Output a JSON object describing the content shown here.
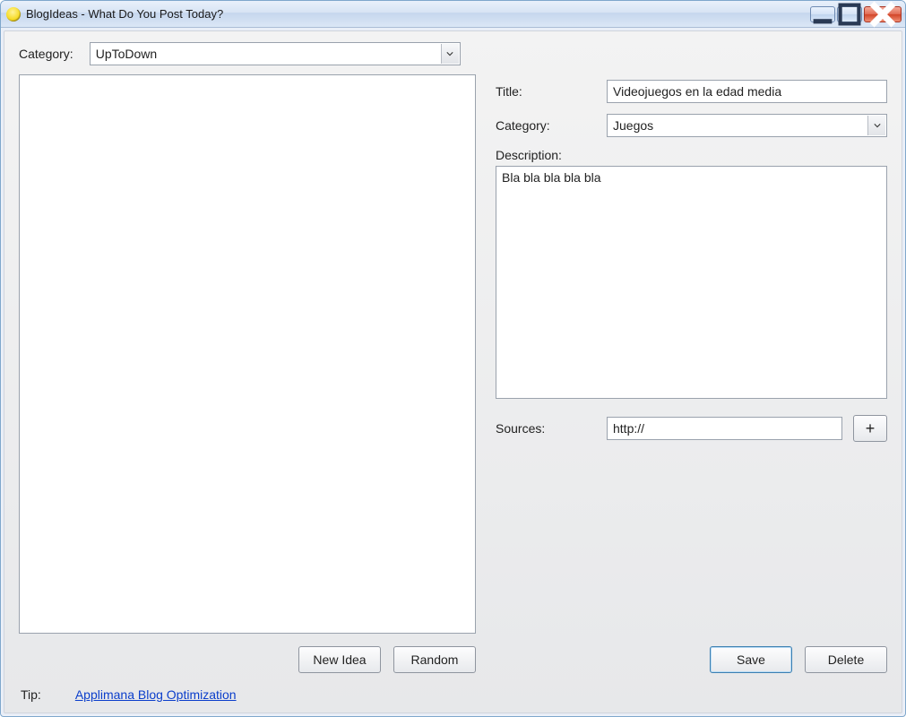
{
  "window": {
    "title": "BlogIdeas - What Do You Post Today?"
  },
  "left": {
    "category_label": "Category:",
    "category_value": "UpToDown",
    "new_idea_label": "New Idea",
    "random_label": "Random"
  },
  "right": {
    "title_label": "Title:",
    "title_value": "Videojuegos en la edad media",
    "category_label": "Category:",
    "category_value": "Juegos",
    "description_label": "Description:",
    "description_value": "Bla bla bla bla bla",
    "sources_label": "Sources:",
    "sources_value": "http://",
    "add_source_label": "+",
    "save_label": "Save",
    "delete_label": "Delete"
  },
  "footer": {
    "tip_label": "Tip:",
    "tip_link": "Applimana Blog Optimization"
  }
}
